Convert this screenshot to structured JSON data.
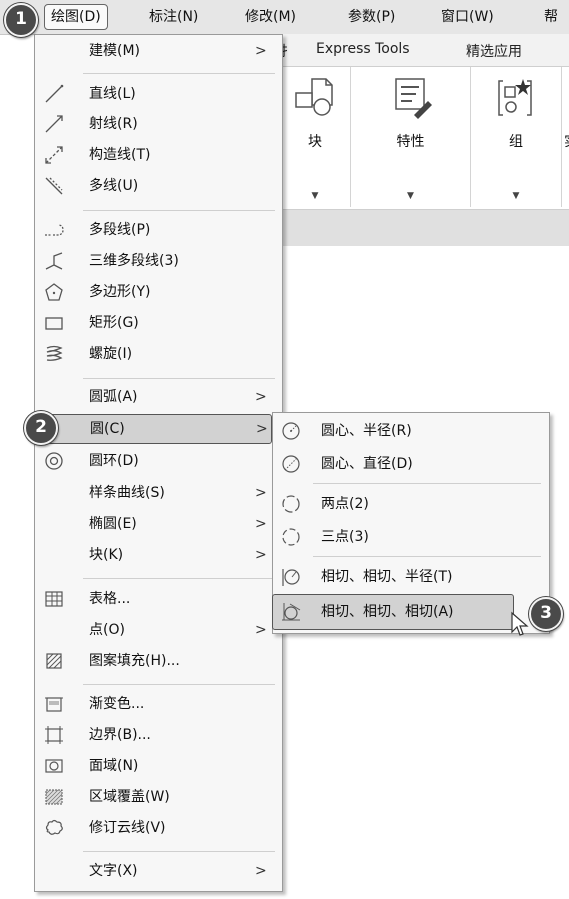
{
  "menubar": {
    "items": [
      {
        "label": "绘图(D)",
        "active": true
      },
      {
        "label": "标注(N)"
      },
      {
        "label": "修改(M)"
      },
      {
        "label": "参数(P)"
      },
      {
        "label": "窗口(W)"
      },
      {
        "label": "帮"
      }
    ]
  },
  "ribbon": {
    "tabs": [
      "扌",
      "Express Tools",
      "精选应用"
    ],
    "groups": [
      {
        "label": "块",
        "icon": "block-insert-icon"
      },
      {
        "label": "特性",
        "icon": "properties-icon"
      },
      {
        "label": "组",
        "icon": "group-icon"
      },
      {
        "label": "实",
        "icon": "utility-icon"
      }
    ],
    "dropdown_arrow": "▼"
  },
  "draw_menu": {
    "items": [
      {
        "label": "建模(M)",
        "icon": "",
        "submenu": true
      },
      {
        "label": "直线(L)",
        "icon": "line-icon"
      },
      {
        "label": "射线(R)",
        "icon": "ray-icon"
      },
      {
        "label": "构造线(T)",
        "icon": "xline-icon"
      },
      {
        "label": "多线(U)",
        "icon": "multiline-icon"
      },
      {
        "label": "多段线(P)",
        "icon": "polyline-icon"
      },
      {
        "label": "三维多段线(3)",
        "icon": "3d-polyline-icon"
      },
      {
        "label": "多边形(Y)",
        "icon": "polygon-icon"
      },
      {
        "label": "矩形(G)",
        "icon": "rectangle-icon"
      },
      {
        "label": "螺旋(I)",
        "icon": "helix-icon"
      },
      {
        "label": "圆弧(A)",
        "icon": "",
        "submenu": true
      },
      {
        "label": "圆(C)",
        "icon": "",
        "submenu": true,
        "highlighted": true
      },
      {
        "label": "圆环(D)",
        "icon": "donut-icon"
      },
      {
        "label": "样条曲线(S)",
        "icon": "",
        "submenu": true
      },
      {
        "label": "椭圆(E)",
        "icon": "",
        "submenu": true
      },
      {
        "label": "块(K)",
        "icon": "",
        "submenu": true
      },
      {
        "label": "表格...",
        "icon": "table-icon"
      },
      {
        "label": "点(O)",
        "icon": "",
        "submenu": true
      },
      {
        "label": "图案填充(H)...",
        "icon": "hatch-icon"
      },
      {
        "label": "渐变色...",
        "icon": "gradient-icon"
      },
      {
        "label": "边界(B)...",
        "icon": "boundary-icon"
      },
      {
        "label": "面域(N)",
        "icon": "region-icon"
      },
      {
        "label": "区域覆盖(W)",
        "icon": "wipeout-icon"
      },
      {
        "label": "修订云线(V)",
        "icon": "revcloud-icon"
      },
      {
        "label": "文字(X)",
        "icon": "",
        "submenu": true
      }
    ],
    "submenu_arrow": ">"
  },
  "circle_menu": {
    "items": [
      {
        "label": "圆心、半径(R)",
        "icon": "circle-center-radius-icon"
      },
      {
        "label": "圆心、直径(D)",
        "icon": "circle-center-diameter-icon"
      },
      {
        "label": "两点(2)",
        "icon": "circle-2point-icon"
      },
      {
        "label": "三点(3)",
        "icon": "circle-3point-icon"
      },
      {
        "label": "相切、相切、半径(T)",
        "icon": "circle-ttr-icon"
      },
      {
        "label": "相切、相切、相切(A)",
        "icon": "circle-ttt-icon",
        "highlighted": true
      }
    ]
  },
  "callouts": [
    "1",
    "2",
    "3"
  ]
}
